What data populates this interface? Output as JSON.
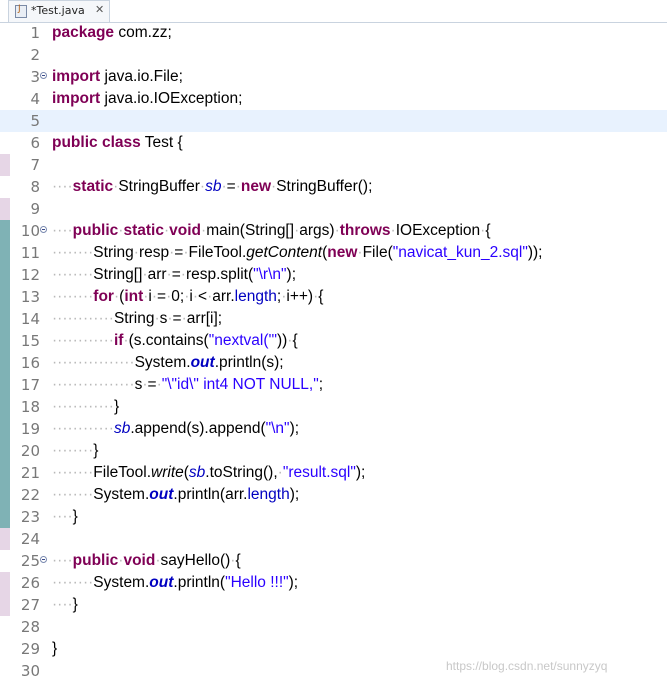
{
  "tab": {
    "title": "*Test.java",
    "close_icon": "✕"
  },
  "watermark": "https://blog.csdn.net/sunnyzyq",
  "colors": {
    "keyword": "#7f0055",
    "string": "#2a00ff",
    "field": "#0000c0",
    "current_line": "#e8f2fe"
  },
  "current_line": 5,
  "lines": [
    {
      "n": "1",
      "tokens": [
        [
          "kw",
          "package"
        ],
        [
          "t",
          " com.zz;"
        ]
      ]
    },
    {
      "n": "2",
      "tokens": []
    },
    {
      "n": "3",
      "fold": true,
      "tokens": [
        [
          "kw",
          "import"
        ],
        [
          "t",
          " java.io.File;"
        ]
      ]
    },
    {
      "n": "4",
      "tokens": [
        [
          "kw",
          "import"
        ],
        [
          "t",
          " java.io.IOException;"
        ]
      ]
    },
    {
      "n": "5",
      "tokens": []
    },
    {
      "n": "6",
      "tokens": [
        [
          "kw",
          "public"
        ],
        [
          "t",
          " "
        ],
        [
          "kw",
          "class"
        ],
        [
          "t",
          " Test {"
        ]
      ]
    },
    {
      "n": "7",
      "tokens": []
    },
    {
      "n": "8",
      "tokens": [
        [
          "ws",
          "····"
        ],
        [
          "kw",
          "static"
        ],
        [
          "ws",
          "·"
        ],
        [
          "t",
          "StringBuffer"
        ],
        [
          "ws",
          "·"
        ],
        [
          "fi",
          "sb"
        ],
        [
          "ws",
          "·"
        ],
        [
          "t",
          "="
        ],
        [
          "ws",
          "·"
        ],
        [
          "kw",
          "new"
        ],
        [
          "ws",
          "·"
        ],
        [
          "t",
          "StringBuffer();"
        ]
      ]
    },
    {
      "n": "9",
      "tokens": []
    },
    {
      "n": "10",
      "fold": true,
      "tokens": [
        [
          "ws",
          "····"
        ],
        [
          "kw",
          "public"
        ],
        [
          "ws",
          "·"
        ],
        [
          "kw",
          "static"
        ],
        [
          "ws",
          "·"
        ],
        [
          "kw",
          "void"
        ],
        [
          "ws",
          "·"
        ],
        [
          "t",
          "main(String[]"
        ],
        [
          "ws",
          "·"
        ],
        [
          "t",
          "args)"
        ],
        [
          "ws",
          "·"
        ],
        [
          "kw",
          "throws"
        ],
        [
          "ws",
          "·"
        ],
        [
          "t",
          "IOException"
        ],
        [
          "ws",
          "·"
        ],
        [
          "t",
          "{"
        ]
      ]
    },
    {
      "n": "11",
      "tokens": [
        [
          "ws",
          "········"
        ],
        [
          "t",
          "String"
        ],
        [
          "ws",
          "·"
        ],
        [
          "t",
          "resp"
        ],
        [
          "ws",
          "·"
        ],
        [
          "t",
          "="
        ],
        [
          "ws",
          "·"
        ],
        [
          "t",
          "FileTool."
        ],
        [
          "sm",
          "getContent"
        ],
        [
          "t",
          "("
        ],
        [
          "kw",
          "new"
        ],
        [
          "ws",
          "·"
        ],
        [
          "t",
          "File("
        ],
        [
          "s",
          "\"navicat_kun_2.sql\""
        ],
        [
          "t",
          "));"
        ]
      ]
    },
    {
      "n": "12",
      "tokens": [
        [
          "ws",
          "········"
        ],
        [
          "t",
          "String[]"
        ],
        [
          "ws",
          "·"
        ],
        [
          "t",
          "arr"
        ],
        [
          "ws",
          "·"
        ],
        [
          "t",
          "="
        ],
        [
          "ws",
          "·"
        ],
        [
          "t",
          "resp.split("
        ],
        [
          "s",
          "\"\\r\\n\""
        ],
        [
          "t",
          ");"
        ]
      ]
    },
    {
      "n": "13",
      "tokens": [
        [
          "ws",
          "········"
        ],
        [
          "kw",
          "for"
        ],
        [
          "ws",
          "·"
        ],
        [
          "t",
          "("
        ],
        [
          "kw",
          "int"
        ],
        [
          "ws",
          "·"
        ],
        [
          "t",
          "i"
        ],
        [
          "ws",
          "·"
        ],
        [
          "t",
          "="
        ],
        [
          "ws",
          "·"
        ],
        [
          "t",
          "0;"
        ],
        [
          "ws",
          "·"
        ],
        [
          "t",
          "i"
        ],
        [
          "ws",
          "·"
        ],
        [
          "t",
          "<"
        ],
        [
          "ws",
          "·"
        ],
        [
          "t",
          "arr."
        ],
        [
          "f",
          "length"
        ],
        [
          "t",
          ";"
        ],
        [
          "ws",
          "·"
        ],
        [
          "t",
          "i++)"
        ],
        [
          "ws",
          "·"
        ],
        [
          "t",
          "{"
        ]
      ]
    },
    {
      "n": "14",
      "tokens": [
        [
          "ws",
          "············"
        ],
        [
          "t",
          "String"
        ],
        [
          "ws",
          "·"
        ],
        [
          "t",
          "s"
        ],
        [
          "ws",
          "·"
        ],
        [
          "t",
          "="
        ],
        [
          "ws",
          "·"
        ],
        [
          "t",
          "arr[i];"
        ]
      ]
    },
    {
      "n": "15",
      "tokens": [
        [
          "ws",
          "············"
        ],
        [
          "kw",
          "if"
        ],
        [
          "ws",
          "·"
        ],
        [
          "t",
          "(s.contains("
        ],
        [
          "s",
          "\"nextval('\""
        ],
        [
          "t",
          "))"
        ],
        [
          "ws",
          "·"
        ],
        [
          "t",
          "{"
        ]
      ]
    },
    {
      "n": "16",
      "tokens": [
        [
          "ws",
          "················"
        ],
        [
          "t",
          "System."
        ],
        [
          "sf",
          "out"
        ],
        [
          "t",
          ".println(s);"
        ]
      ]
    },
    {
      "n": "17",
      "tokens": [
        [
          "ws",
          "················"
        ],
        [
          "t",
          "s"
        ],
        [
          "ws",
          "·"
        ],
        [
          "t",
          "="
        ],
        [
          "ws",
          "·"
        ],
        [
          "s",
          "\"\\\"id\\\" int4 NOT NULL,\""
        ],
        [
          "t",
          ";"
        ]
      ]
    },
    {
      "n": "18",
      "tokens": [
        [
          "ws",
          "············"
        ],
        [
          "t",
          "}"
        ]
      ]
    },
    {
      "n": "19",
      "tokens": [
        [
          "ws",
          "············"
        ],
        [
          "fi",
          "sb"
        ],
        [
          "t",
          ".append(s).append("
        ],
        [
          "s",
          "\"\\n\""
        ],
        [
          "t",
          ");"
        ]
      ]
    },
    {
      "n": "20",
      "tokens": [
        [
          "ws",
          "········"
        ],
        [
          "t",
          "}"
        ]
      ]
    },
    {
      "n": "21",
      "tokens": [
        [
          "ws",
          "········"
        ],
        [
          "t",
          "FileTool."
        ],
        [
          "sm",
          "write"
        ],
        [
          "t",
          "("
        ],
        [
          "fi",
          "sb"
        ],
        [
          "t",
          ".toString(),"
        ],
        [
          "ws",
          "·"
        ],
        [
          "s",
          "\"result.sql\""
        ],
        [
          "t",
          ");"
        ]
      ]
    },
    {
      "n": "22",
      "tokens": [
        [
          "ws",
          "········"
        ],
        [
          "t",
          "System."
        ],
        [
          "sf",
          "out"
        ],
        [
          "t",
          ".println(arr."
        ],
        [
          "f",
          "length"
        ],
        [
          "t",
          ");"
        ]
      ]
    },
    {
      "n": "23",
      "tokens": [
        [
          "ws",
          "····"
        ],
        [
          "t",
          "}"
        ]
      ]
    },
    {
      "n": "24",
      "tokens": []
    },
    {
      "n": "25",
      "fold": true,
      "tokens": [
        [
          "ws",
          "····"
        ],
        [
          "kw",
          "public"
        ],
        [
          "ws",
          "·"
        ],
        [
          "kw",
          "void"
        ],
        [
          "ws",
          "·"
        ],
        [
          "t",
          "sayHello()"
        ],
        [
          "ws",
          "·"
        ],
        [
          "t",
          "{"
        ]
      ]
    },
    {
      "n": "26",
      "tokens": [
        [
          "ws",
          "········"
        ],
        [
          "t",
          "System."
        ],
        [
          "sf",
          "out"
        ],
        [
          "t",
          ".println("
        ],
        [
          "s",
          "\"Hello !!!\""
        ],
        [
          "t",
          ");"
        ]
      ]
    },
    {
      "n": "27",
      "tokens": [
        [
          "ws",
          "····"
        ],
        [
          "t",
          "}"
        ]
      ]
    },
    {
      "n": "28",
      "tokens": []
    },
    {
      "n": "29",
      "tokens": [
        [
          "t",
          "}"
        ]
      ]
    },
    {
      "n": "30",
      "tokens": []
    }
  ]
}
